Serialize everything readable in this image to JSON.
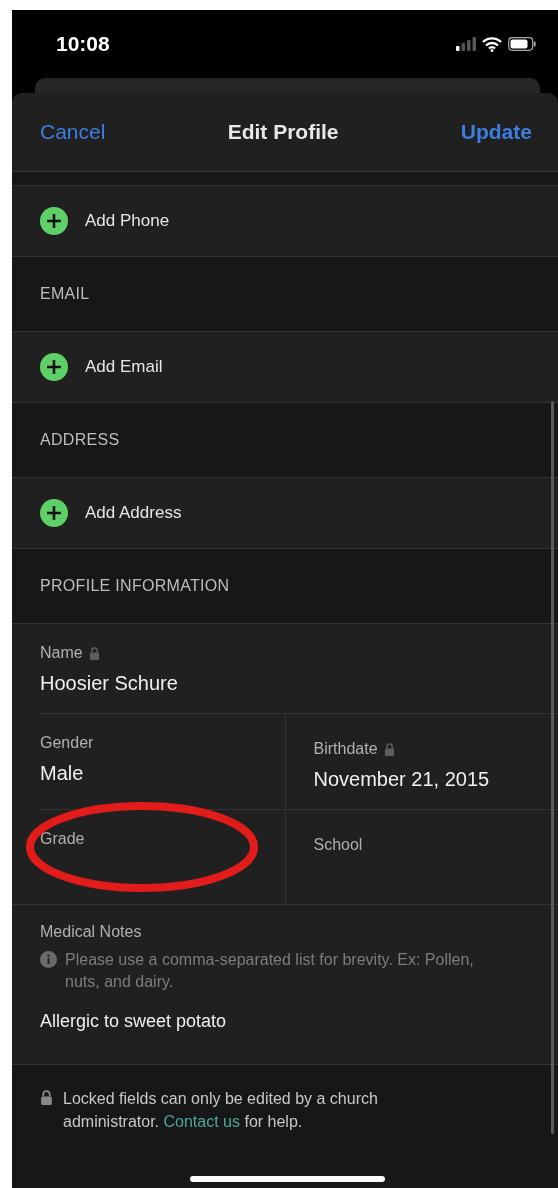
{
  "status_bar": {
    "time": "10:08"
  },
  "nav": {
    "cancel": "Cancel",
    "title": "Edit Profile",
    "update": "Update"
  },
  "sections": [
    {
      "add_label": "Add Phone"
    },
    {
      "header": "EMAIL",
      "add_label": "Add Email"
    },
    {
      "header": "ADDRESS",
      "add_label": "Add Address"
    }
  ],
  "profile": {
    "header": "PROFILE INFORMATION",
    "rows": [
      {
        "cells": [
          {
            "label": "Name",
            "locked": true,
            "value": "Hoosier Schure"
          }
        ]
      },
      {
        "cells": [
          {
            "label": "Gender",
            "locked": false,
            "value": "Male"
          },
          {
            "label": "Birthdate",
            "locked": true,
            "value": "November 21, 2015"
          }
        ]
      },
      {
        "cells": [
          {
            "label": "Grade",
            "locked": false,
            "annotation": {
              "kind": "ellipse"
            }
          },
          {
            "label": "School",
            "locked": false
          }
        ]
      }
    ]
  },
  "medical": {
    "label": "Medical Notes",
    "hint": "Please use a comma-separated list for brevity. Ex: Pollen, nuts, and dairy.",
    "value": "Allergic to sweet potato"
  },
  "footer": {
    "text_before": "Locked fields can only be edited by a church administrator.",
    "link": "Contact us",
    "text_after": "for help."
  }
}
